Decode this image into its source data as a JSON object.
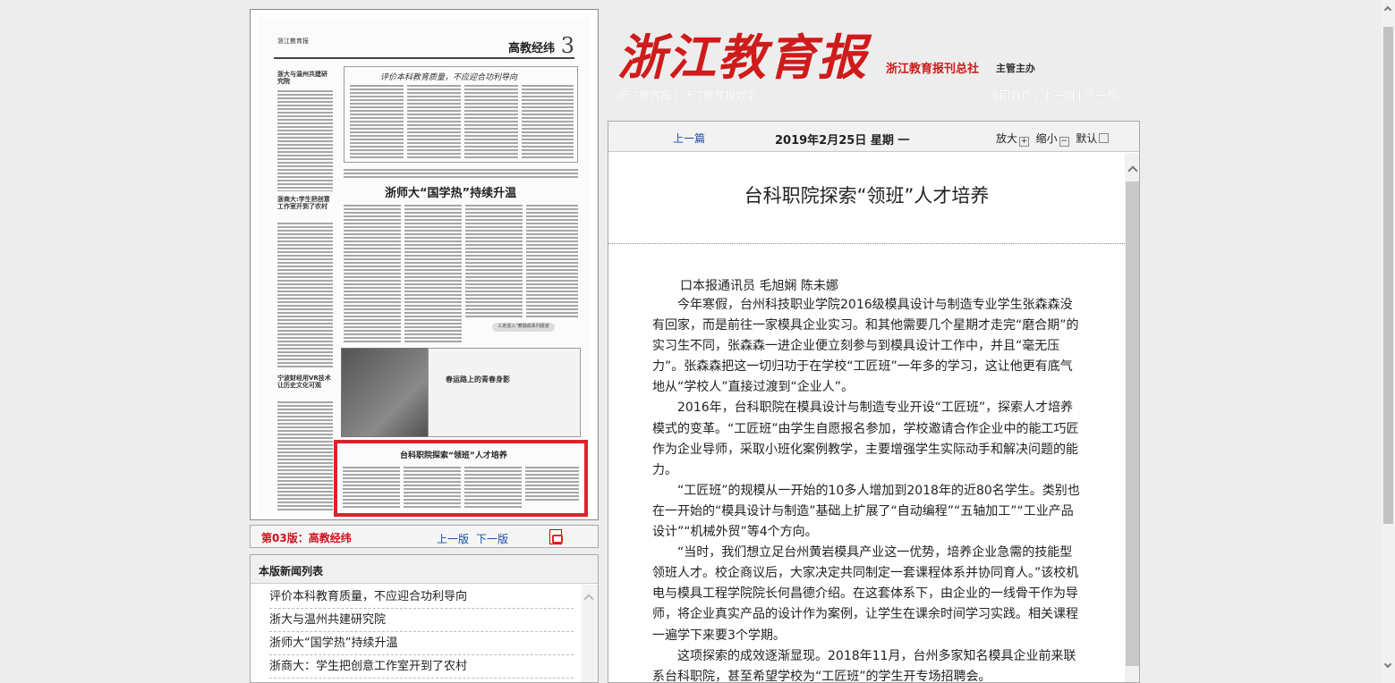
{
  "masthead": {
    "logo": "浙江教育报",
    "publisher": "浙江教育报刊总社",
    "sponsor": "主管主办",
    "links_left": [
      "浙江教育报",
      "浙江教育报数字"
    ],
    "links_right": [
      "返回首页",
      "上一期",
      "下一期"
    ]
  },
  "scan": {
    "paper_name": "浙江教育报",
    "section": "高教经纬",
    "page_number": "3",
    "box_headline": "评价本科教育质量，不应迎合功利导向",
    "big_headline": "浙师大“国学热”持续升温",
    "side_headlines": [
      "浙大与温州共建研究院",
      "浙商大:学生把创意工作室开到了农村",
      "宁波财经用VR技术让历史文化可观"
    ],
    "stamp_text": "三走进入“教融成系列报道",
    "photo_caption": "春运路上的青春身影",
    "highlight_headline": "台科职院探索“领班”人才培养"
  },
  "edition": {
    "label": "第03版：高教经纬",
    "prev": "上一版",
    "next": "下一版",
    "pdf_icon": "pdf-icon"
  },
  "news": {
    "heading": "本版新闻列表",
    "items": [
      "评价本科教育质量，不应迎合功利导向",
      "浙大与温州共建研究院",
      "浙师大“国学热”持续升温",
      "浙商大：学生把创意工作室开到了农村"
    ]
  },
  "article": {
    "prev": "上一篇",
    "date": "2019年2月25日 星期 一",
    "zoom_in": "放大",
    "zoom_out": "缩小",
    "default": "默认",
    "title": "台科职院探索“领班”人才培养",
    "byline": "口本报通讯员 毛旭娴 陈未娜",
    "paragraphs": [
      "今年寒假，台州科技职业学院2016级模具设计与制造专业学生张森森没有回家，而是前往一家模具企业实习。和其他需要几个星期才走完“磨合期”的实习生不同，张森森一进企业便立刻参与到模具设计工作中，并且“毫无压力”。张森森把这一切归功于在学校“工匠班”一年多的学习，这让他更有底气地从“学校人”直接过渡到“企业人”。",
      "2016年，台科职院在模具设计与制造专业开设“工匠班”，探索人才培养模式的变革。“工匠班”由学生自愿报名参加，学校邀请合作企业中的能工巧匠作为企业导师，采取小班化案例教学，主要增强学生实际动手和解决问题的能力。",
      "“工匠班”的规模从一开始的10多人增加到2018年的近80名学生。类别也在一开始的“模具设计与制造”基础上扩展了“自动编程”“五轴加工”“工业产品设计”“机械外贸”等4个方向。",
      "“当时，我们想立足台州黄岩模具产业这一优势，培养企业急需的技能型领班人才。校企商议后，大家决定共同制定一套课程体系并协同育人。”该校机电与模具工程学院院长何昌德介绍。在这套体系下，由企业的一线骨干作为导师，将企业真实产品的设计作为案例，让学生在课余时间学习实践。相关课程一遍学下来要3个学期。",
      "这项探索的成效逐渐显现。2018年11月，台州多家知名模具企业前来联系台科职院，甚至希望学校为“工匠班”的学生开专场招聘会。"
    ]
  },
  "colors": {
    "brand_red": "#cf1b1b",
    "link_blue": "#1d4ea1",
    "highlight_red": "#e0212a"
  }
}
